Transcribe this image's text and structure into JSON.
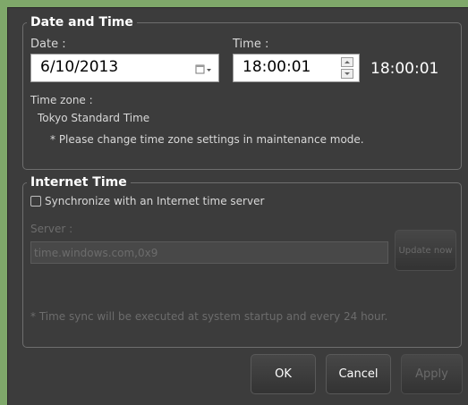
{
  "date_time": {
    "legend": "Date and Time",
    "date_label": "Date :",
    "date_value": "6/10/2013",
    "time_label": "Time :",
    "time_value": "18:00:01",
    "time_display": "18:00:01",
    "timezone_label": "Time zone :",
    "timezone_value": "Tokyo Standard Time",
    "timezone_note": "* Please change time zone settings in maintenance mode."
  },
  "internet_time": {
    "legend": "Internet Time",
    "sync_label": "Synchronize with an Internet time server",
    "sync_checked": false,
    "server_label": "Server :",
    "server_value": "time.windows.com,0x9",
    "update_button": "Update now",
    "sync_note": "* Time sync will be executed at system startup and every 24 hour."
  },
  "buttons": {
    "ok": "OK",
    "cancel": "Cancel",
    "apply": "Apply"
  },
  "colors": {
    "background": "#3c3c3c",
    "outer": "#7fa86a",
    "text": "#ffffff",
    "disabled_text": "#6c6c6c"
  }
}
